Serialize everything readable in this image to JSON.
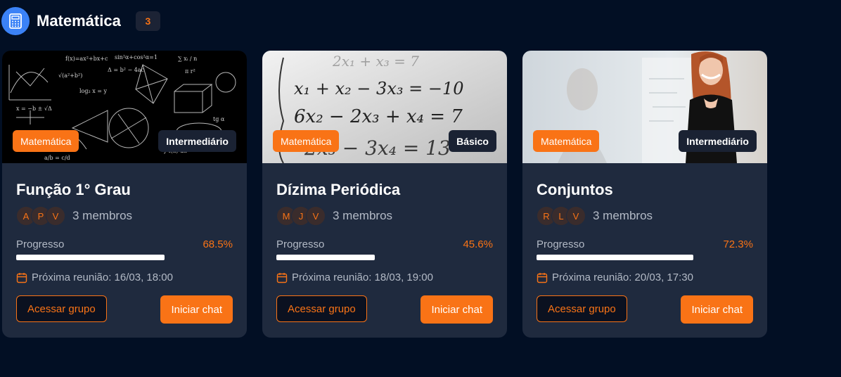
{
  "section": {
    "icon": "calculator-icon",
    "title": "Matemática",
    "count": "3"
  },
  "colors": {
    "accent": "#f97316",
    "background": "#020f24",
    "card": "#1f2a3e",
    "icon_bg": "#3b82f6"
  },
  "cards": [
    {
      "image": "chalkboard-math-formulas",
      "subject": "Matemática",
      "level": "Intermediário",
      "title": "Função 1° Grau",
      "avatars": [
        "A",
        "P",
        "V"
      ],
      "members": "3 membros",
      "progress_label": "Progresso",
      "progress_text": "68.5%",
      "progress": 0.685,
      "meeting": "Próxima reunião: 16/03, 18:00",
      "access_label": "Acessar grupo",
      "chat_label": "Iniciar chat"
    },
    {
      "image": "linear-equations-paper",
      "subject": "Matemática",
      "level": "Básico",
      "title": "Dízima Periódica",
      "avatars": [
        "M",
        "J",
        "V"
      ],
      "members": "3 membros",
      "progress_label": "Progresso",
      "progress_text": "45.6%",
      "progress": 0.456,
      "meeting": "Próxima reunião: 18/03, 19:00",
      "access_label": "Acessar grupo",
      "chat_label": "Iniciar chat"
    },
    {
      "image": "teacher-at-whiteboard",
      "subject": "Matemática",
      "level": "Intermediário",
      "title": "Conjuntos",
      "avatars": [
        "R",
        "L",
        "V"
      ],
      "members": "3 membros",
      "progress_label": "Progresso",
      "progress_text": "72.3%",
      "progress": 0.723,
      "meeting": "Próxima reunião: 20/03, 17:30",
      "access_label": "Acessar grupo",
      "chat_label": "Iniciar chat"
    }
  ]
}
